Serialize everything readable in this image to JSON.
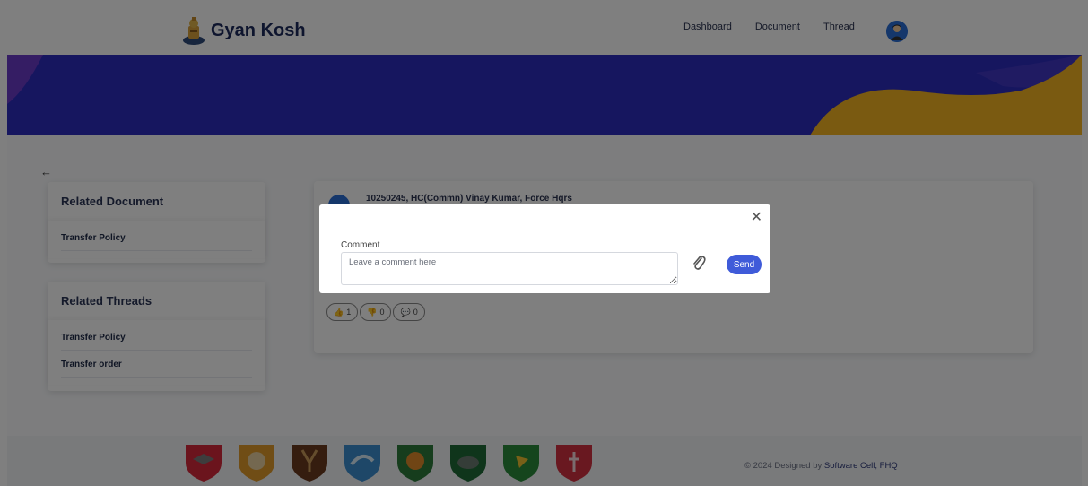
{
  "header": {
    "brand": "Gyan Kosh",
    "nav": [
      "Dashboard",
      "Document",
      "Thread"
    ]
  },
  "sidebar": {
    "documents": {
      "title": "Related Document",
      "items": [
        "Transfer Policy"
      ]
    },
    "threads": {
      "title": "Related Threads",
      "items": [
        "Transfer Policy",
        "Transfer order"
      ]
    }
  },
  "thread": {
    "author": "10250245, HC(Commn) Vinay Kumar, Force Hqrs",
    "likes": "1",
    "dislikes": "0",
    "comments": "0"
  },
  "modal": {
    "label": "Comment",
    "placeholder": "Leave a comment here",
    "send_label": "Send"
  },
  "footer": {
    "copyright_prefix": "© 2024 Designed by",
    "copyright_link": "Software Cell, FHQ"
  },
  "colors": {
    "banner": "#2c2cbf",
    "wave": "#f5b423",
    "accent": "#3f5bd9",
    "brand_text": "#1d2a5c"
  }
}
